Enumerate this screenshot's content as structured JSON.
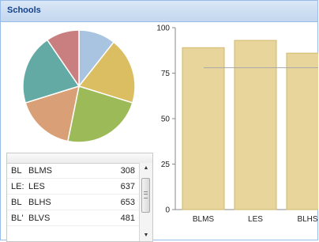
{
  "panel": {
    "title": "Schools"
  },
  "colors": {
    "header_bg": "#c8daf1",
    "title_text": "#15428b",
    "bar_fill": "#e7d59b",
    "bar_stroke": "#d2b96a",
    "pie_slices": [
      "#a8c4e0",
      "#dbbe62",
      "#9dba58",
      "#d9a078",
      "#64aaa4",
      "#c97f80"
    ]
  },
  "grid": {
    "rows": [
      {
        "abbr": "BL",
        "name": "BLMS",
        "value": "308"
      },
      {
        "abbr": "LE:",
        "name": "LES",
        "value": "637"
      },
      {
        "abbr": "BL",
        "name": "BLHS",
        "value": "653"
      },
      {
        "abbr": "BL'",
        "name": "BLVS",
        "value": "481"
      }
    ],
    "scroll": {
      "up_icon": "▲",
      "down_icon": "▼"
    }
  },
  "chart_data": [
    {
      "type": "pie",
      "labels": [],
      "values": [
        10,
        18,
        22,
        16,
        19,
        9
      ]
    },
    {
      "type": "bar",
      "categories": [
        "BLMS",
        "LES",
        "BLHS"
      ],
      "values": [
        89,
        93,
        86
      ],
      "ylim": [
        0,
        100
      ],
      "yticks": [
        0,
        25,
        50,
        75,
        100
      ],
      "reference_line": 78,
      "grid": true
    }
  ]
}
